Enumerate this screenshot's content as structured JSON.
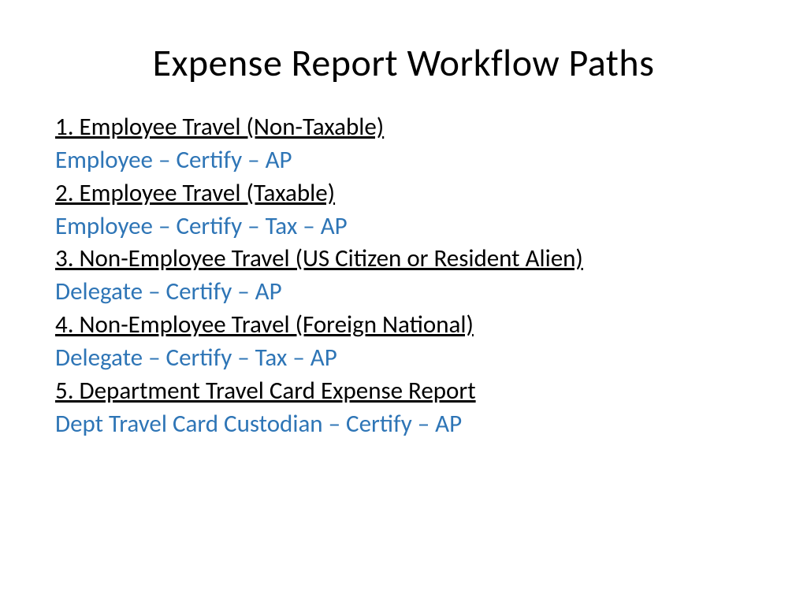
{
  "title": "Expense Report Workflow Paths",
  "items": [
    {
      "heading": "1. Employee Travel (Non-Taxable)",
      "path": "Employee – Certify – AP"
    },
    {
      "heading": "2. Employee Travel (Taxable)",
      "path": "Employee – Certify – Tax – AP"
    },
    {
      "heading": "3. Non-Employee Travel (US Citizen or Resident Alien)",
      "path": "Delegate – Certify – AP"
    },
    {
      "heading": "4. Non-Employee Travel (Foreign National)",
      "path": "Delegate – Certify – Tax – AP"
    },
    {
      "heading": "5. Department Travel Card Expense Report",
      "path": "Dept Travel Card Custodian – Certify – AP"
    }
  ]
}
